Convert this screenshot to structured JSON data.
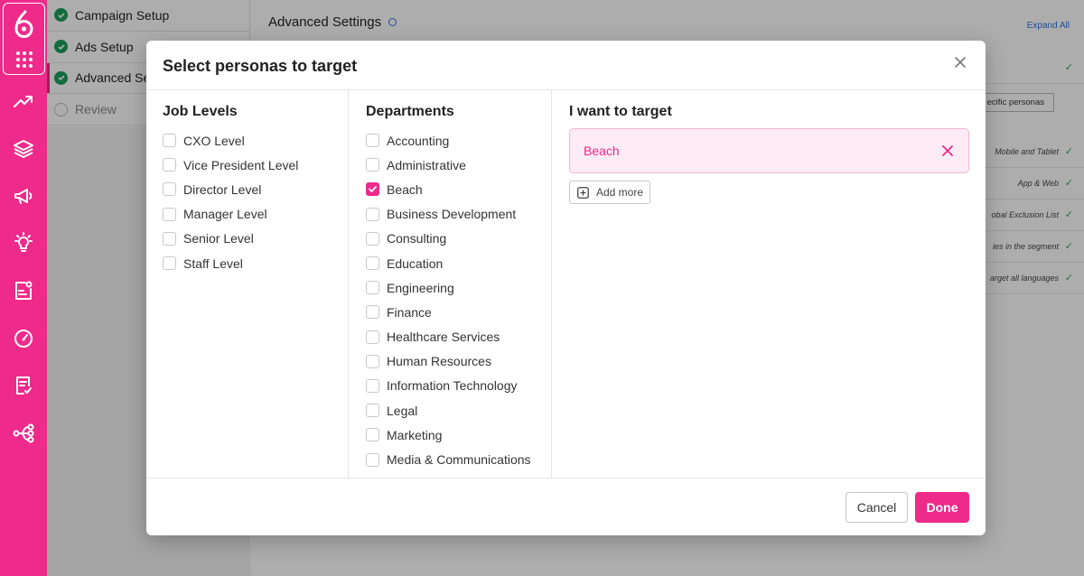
{
  "steps": [
    {
      "label": "Campaign Setup",
      "state": "done"
    },
    {
      "label": "Ads Setup",
      "state": "done"
    },
    {
      "label": "Advanced Se",
      "state": "active"
    },
    {
      "label": "Review",
      "state": "pending"
    }
  ],
  "main": {
    "title": "Advanced Settings",
    "expand_all": "Expand All",
    "specific_personas_btn": "ecific personas",
    "rows": [
      "Mobile and Tablet",
      "App & Web",
      "obal Exclusion List",
      "ies in the segment",
      "arget all languages"
    ]
  },
  "modal": {
    "title": "Select personas to target",
    "job_levels": {
      "heading": "Job Levels",
      "options": [
        "CXO Level",
        "Vice President Level",
        "Director Level",
        "Manager Level",
        "Senior Level",
        "Staff Level"
      ]
    },
    "departments": {
      "heading": "Departments",
      "options": [
        "Accounting",
        "Administrative",
        "Beach",
        "Business Development",
        "Consulting",
        "Education",
        "Engineering",
        "Finance",
        "Healthcare Services",
        "Human Resources",
        "Information Technology",
        "Legal",
        "Marketing",
        "Media & Communications",
        "Media & Communications"
      ],
      "checked": [
        "Beach"
      ]
    },
    "target": {
      "heading": "I want to target",
      "items": [
        "Beach"
      ],
      "add_more": "Add more"
    },
    "footer": {
      "cancel": "Cancel",
      "done": "Done"
    }
  },
  "colors": {
    "brand": "#ee2a8b",
    "chip_bg": "#fdebf5",
    "success": "#1e9e5a"
  },
  "icons": [
    "logo-icon",
    "apps-grid-icon",
    "trending-icon",
    "layers-icon",
    "megaphone-icon",
    "lightbulb-icon",
    "campaign-card-icon",
    "speedometer-icon",
    "report-icon",
    "network-icon",
    "close-icon",
    "remove-icon",
    "add-square-icon",
    "check-icon",
    "info-icon"
  ]
}
